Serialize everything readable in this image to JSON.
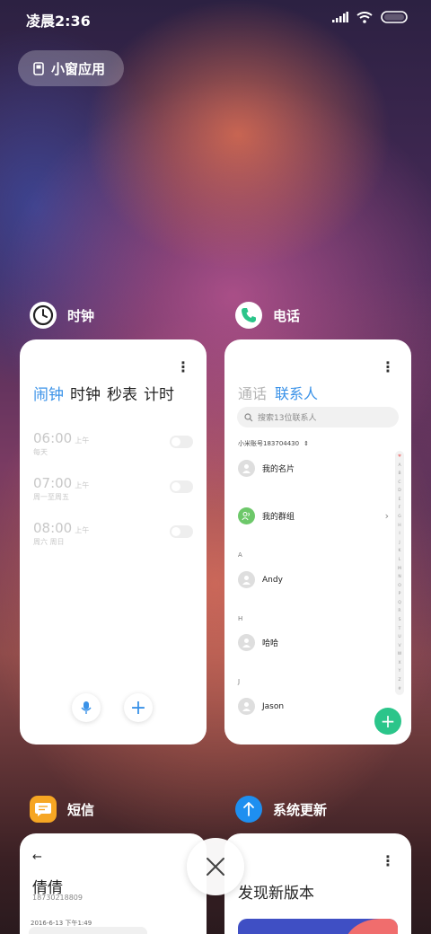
{
  "status_bar": {
    "time": "凌晨2:36"
  },
  "mini_window": {
    "label": "小窗应用"
  },
  "apps": {
    "clock": {
      "name": "时钟",
      "tabs": [
        "闹钟",
        "时钟",
        "秒表",
        "计时"
      ],
      "menu": "⋮",
      "alarms": [
        {
          "time": "06:00",
          "ampm": "上午",
          "repeat": "每天"
        },
        {
          "time": "07:00",
          "ampm": "上午",
          "repeat": "周一至周五"
        },
        {
          "time": "08:00",
          "ampm": "上午",
          "repeat": "周六 周日"
        }
      ],
      "add": "+"
    },
    "phone": {
      "name": "电话",
      "menu": "⋮",
      "tabs": [
        "通话",
        "联系人"
      ],
      "search_placeholder": "搜索13位联系人",
      "account": "小米账号183704430",
      "contacts": [
        {
          "name": "我的名片"
        },
        {
          "name": "我的群组"
        },
        {
          "letter": "A"
        },
        {
          "name": "Andy"
        },
        {
          "letter": "H"
        },
        {
          "name": "哈哈"
        },
        {
          "letter": "J"
        },
        {
          "name": "Jason"
        }
      ],
      "alphabet": [
        "♥",
        "A",
        "B",
        "C",
        "D",
        "E",
        "F",
        "G",
        "H",
        "I",
        "J",
        "K",
        "L",
        "M",
        "N",
        "O",
        "P",
        "Q",
        "R",
        "S",
        "T",
        "U",
        "V",
        "W",
        "X",
        "Y",
        "Z",
        "#"
      ],
      "fab": "+"
    },
    "sms": {
      "name": "短信",
      "back": "←",
      "contact_name": "倩倩",
      "number": "18730218809",
      "timestamp": "2016-6-13 下午1:49"
    },
    "update": {
      "name": "系统更新",
      "menu": "⋮",
      "title": "发现新版本"
    }
  },
  "colors": {
    "accent_blue": "#3a92e8",
    "phone_green": "#2bc58a",
    "sms_orange": "#f6a623",
    "update_blue": "#1e8ff0"
  }
}
